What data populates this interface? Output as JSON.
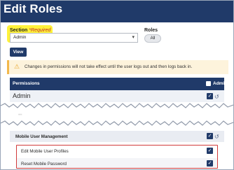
{
  "header": {
    "title": "Edit Roles"
  },
  "section": {
    "label": "Section",
    "required": "*Required",
    "value": "Admin"
  },
  "roles": {
    "label": "Roles",
    "toggle_value": "All"
  },
  "view_button": "View",
  "notice": {
    "message": "Changes in permissions will not take effect until the user logs out and then logs back in."
  },
  "permissions": {
    "header": "Permissions",
    "admin_column": "Admin",
    "rows": [
      {
        "name": "Admin",
        "checked": true
      },
      {
        "name": "...",
        "checked": false
      },
      {
        "name": "Mobile User Management",
        "checked": true
      },
      {
        "name": "Edit Mobile User Profiles",
        "checked": true
      },
      {
        "name": "Reset Mobile Password",
        "checked": true
      }
    ]
  },
  "colors": {
    "navy": "#203a69",
    "highlight": "#fff23a",
    "outline": "#d13a3a",
    "warn": "#f2b84b"
  }
}
